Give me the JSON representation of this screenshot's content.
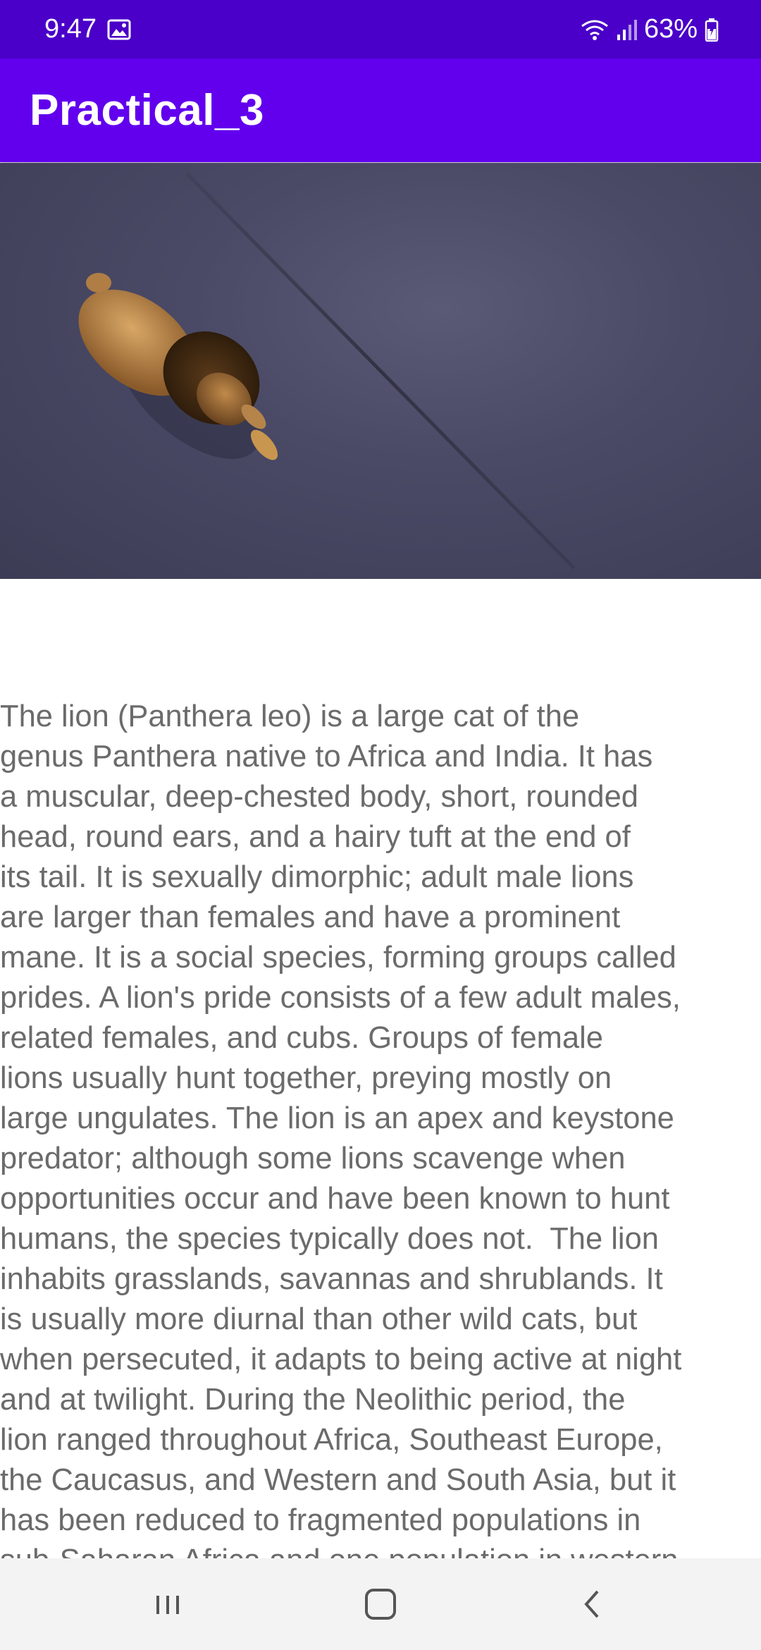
{
  "status_bar": {
    "time": "9:47",
    "battery": "63%",
    "icons": [
      "image-icon",
      "wifi-icon",
      "signal-icon",
      "battery-icon"
    ]
  },
  "app_bar": {
    "title": "Practical_3"
  },
  "hero": {
    "subject": "lion-3d-model"
  },
  "content": {
    "description": "The lion (Panthera leo) is a large cat of the\ngenus Panthera native to Africa and India. It has\na muscular, deep-chested body, short, rounded\nhead, round ears, and a hairy tuft at the end of\nits tail. It is sexually dimorphic; adult male lions\nare larger than females and have a prominent\nmane. It is a social species, forming groups called\nprides. A lion's pride consists of a few adult males,\nrelated females, and cubs. Groups of female\nlions usually hunt together, preying mostly on\nlarge ungulates. The lion is an apex and keystone\npredator; although some lions scavenge when\nopportunities occur and have been known to hunt\nhumans, the species typically does not.  The lion\ninhabits grasslands, savannas and shrublands. It\nis usually more diurnal than other wild cats, but\nwhen persecuted, it adapts to being active at night\nand at twilight. During the Neolithic period, the\nlion ranged throughout Africa, Southeast Europe,\nthe Caucasus, and Western and South Asia, but it\nhas been reduced to fragmented populations in\nsub-Saharan Africa and one population in western"
  },
  "nav_bar": {
    "buttons": [
      "recents-icon",
      "home-icon",
      "back-icon"
    ]
  },
  "colors": {
    "status_bar": "#4a00c8",
    "app_bar": "#6200ee",
    "text": "#6b6b6b",
    "nav_bar": "#f3f3f3"
  }
}
